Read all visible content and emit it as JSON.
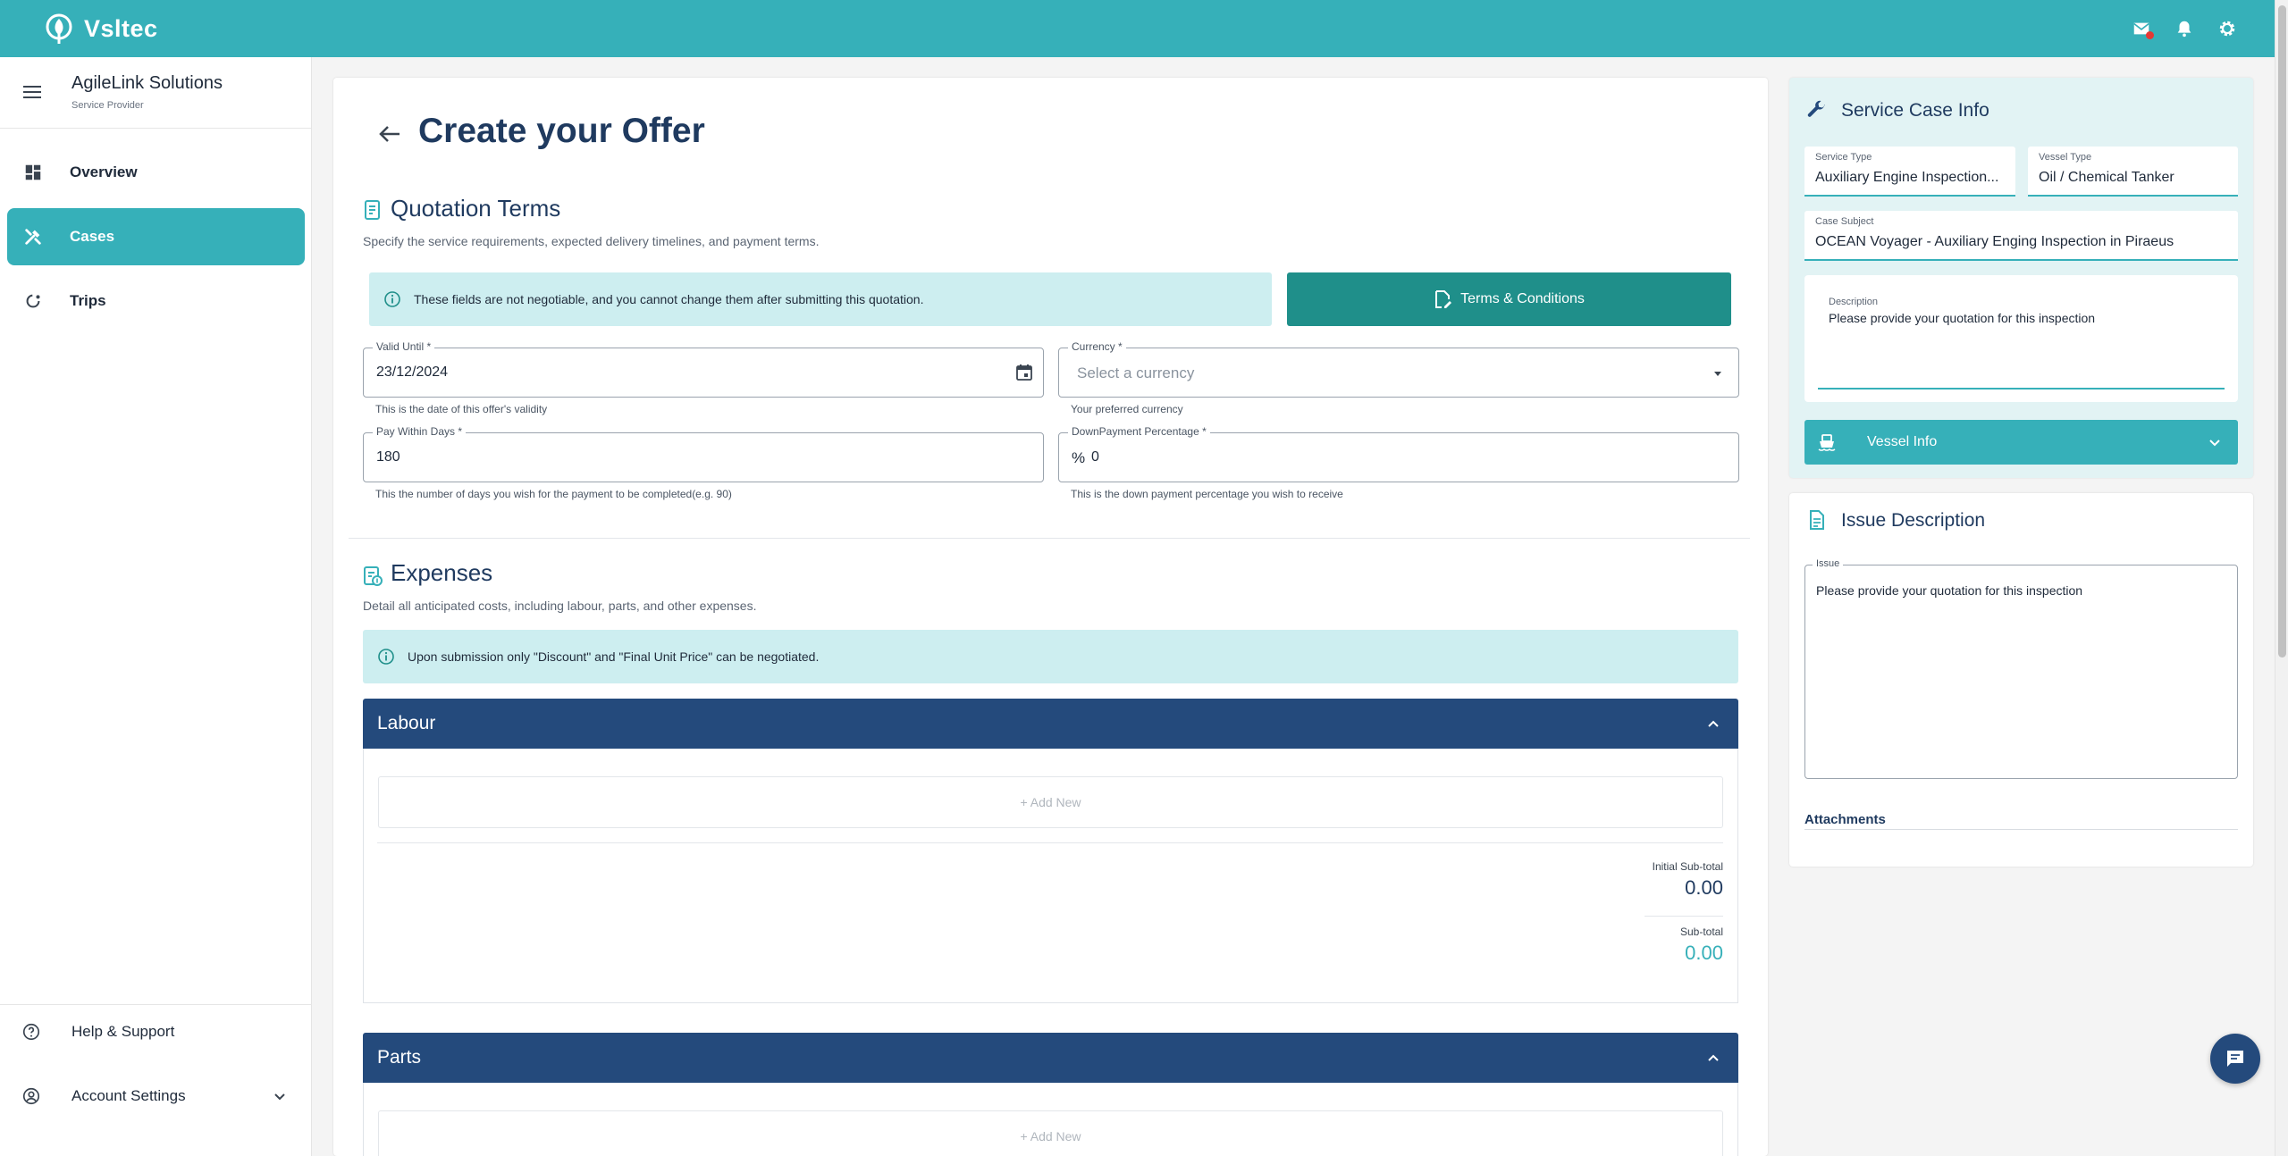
{
  "app": {
    "brand": "Vsltec",
    "colors": {
      "primary": "#36b0b9",
      "navy": "#244a7c",
      "dark_teal": "#1f8f8a",
      "info_bg": "#cdeef0"
    }
  },
  "header": {
    "icons": [
      "mail-icon",
      "bell-icon",
      "gear-icon"
    ]
  },
  "sidebar": {
    "org_name": "AgileLink Solutions",
    "org_role": "Service Provider",
    "items": [
      {
        "label": "Overview",
        "icon": "dashboard-icon",
        "active": false
      },
      {
        "label": "Cases",
        "icon": "tools-icon",
        "active": true
      },
      {
        "label": "Trips",
        "icon": "route-icon",
        "active": false
      }
    ],
    "help_label": "Help & Support",
    "account_label": "Account Settings"
  },
  "main": {
    "title": "Create your Offer",
    "quotation": {
      "title": "Quotation Terms",
      "subtitle": "Specify the service requirements, expected delivery timelines, and payment terms.",
      "notice": "These fields are not negotiable, and you cannot change them after submitting this quotation.",
      "terms_button": "Terms & Conditions",
      "valid_until": {
        "label": "Valid Until *",
        "value": "23/12/2024",
        "helper": "This is the date of this offer's validity"
      },
      "currency": {
        "label": "Currency *",
        "placeholder": "Select a currency",
        "helper": "Your preferred currency"
      },
      "pay_within": {
        "label": "Pay Within Days *",
        "value": "180",
        "helper": "This the number of days you wish for the payment to be completed(e.g. 90)"
      },
      "down_payment": {
        "label": "DownPayment Percentage *",
        "prefix": "%",
        "value": "0",
        "helper": "This is the down payment percentage you wish to receive"
      }
    },
    "expenses": {
      "title": "Expenses",
      "subtitle": "Detail all anticipated costs, including labour, parts, and other expenses.",
      "notice": "Upon submission only \"Discount\" and \"Final Unit Price\" can be negotiated.",
      "labour": {
        "title": "Labour",
        "add_new": "+ Add New",
        "initial_subtotal_label": "Initial Sub-total",
        "initial_subtotal": "0.00",
        "subtotal_label": "Sub-total",
        "subtotal": "0.00"
      },
      "parts": {
        "title": "Parts",
        "add_new": "+ Add New"
      }
    }
  },
  "service_case": {
    "title": "Service Case Info",
    "service_type": {
      "label": "Service Type",
      "value": "Auxiliary Engine Inspection..."
    },
    "vessel_type": {
      "label": "Vessel Type",
      "value": "Oil / Chemical Tanker"
    },
    "case_subject": {
      "label": "Case Subject",
      "value": "OCEAN Voyager - Auxiliary Enging Inspection in Piraeus"
    },
    "description": {
      "label": "Description",
      "value": "Please provide your quotation for this inspection"
    },
    "vessel_info_label": "Vessel Info"
  },
  "issue": {
    "title": "Issue Description",
    "issue_label": "Issue",
    "issue_value": "Please provide your quotation for this inspection",
    "attachments_label": "Attachments"
  }
}
